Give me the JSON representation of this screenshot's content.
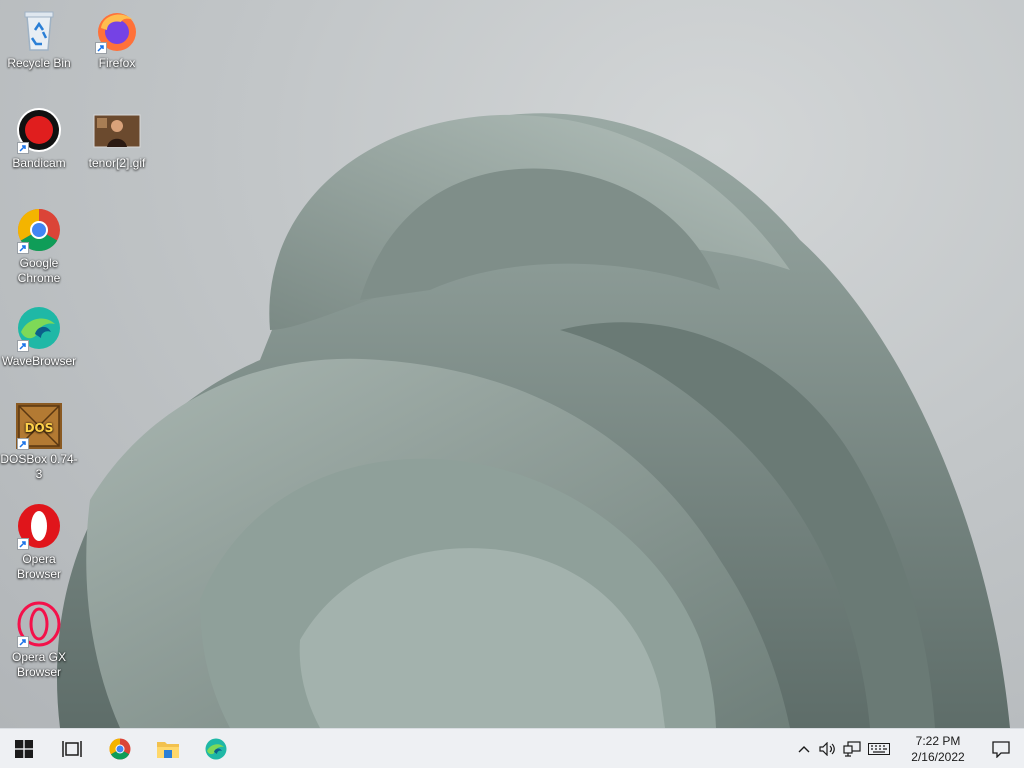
{
  "desktop": {
    "icons": [
      {
        "label": "Recycle Bin",
        "icon": "recycle-bin-icon",
        "shortcut": false
      },
      {
        "label": "Firefox",
        "icon": "firefox-icon",
        "shortcut": true
      },
      {
        "label": "Bandicam",
        "icon": "bandicam-icon",
        "shortcut": true
      },
      {
        "label": "tenor[2].gif",
        "icon": "gif-thumbnail-icon",
        "shortcut": false
      },
      {
        "label": "Google Chrome",
        "icon": "chrome-icon",
        "shortcut": true
      },
      {
        "label": "WaveBrowser",
        "icon": "wavebrowser-icon",
        "shortcut": true
      },
      {
        "label": "DOSBox 0.74-3",
        "icon": "dosbox-icon",
        "shortcut": true
      },
      {
        "label": "Opera Browser",
        "icon": "opera-icon",
        "shortcut": true
      },
      {
        "label": "Opera GX Browser",
        "icon": "opera-gx-icon",
        "shortcut": true
      }
    ],
    "dosbox_logo_text": "DOS"
  },
  "taskbar": {
    "pinned": [
      {
        "name": "start-button",
        "icon": "windows-icon"
      },
      {
        "name": "task-view-button",
        "icon": "task-view-icon"
      },
      {
        "name": "taskbar-chrome",
        "icon": "chrome-icon"
      },
      {
        "name": "taskbar-file-explorer",
        "icon": "folder-icon"
      },
      {
        "name": "taskbar-wavebrowser",
        "icon": "wavebrowser-icon"
      }
    ],
    "tray": {
      "icons": [
        "chevron-up-icon",
        "volume-icon",
        "network-icon",
        "keyboard-icon"
      ],
      "time": "7:22 PM",
      "date": "2/16/2022"
    }
  },
  "colors": {
    "taskbar_bg": "#eef0f3",
    "wallpaper_petal": "#8f9e99",
    "opera_red": "#e0151b",
    "chrome_blue": "#4285f4"
  }
}
